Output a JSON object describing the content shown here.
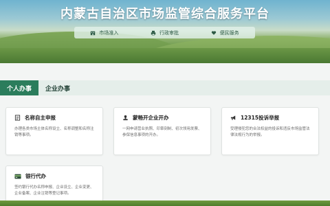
{
  "header": {
    "title": "内蒙古自治区市场监管综合服务平台"
  },
  "nav": [
    {
      "label": "市场准入",
      "icon": "building-icon"
    },
    {
      "label": "行政审批",
      "icon": "printer-icon"
    },
    {
      "label": "便民服务",
      "icon": "heart-hands-icon"
    }
  ],
  "tabs": [
    {
      "label": "个人办事",
      "active": true
    },
    {
      "label": "企业办事",
      "active": false
    }
  ],
  "cards": [
    {
      "title": "名称自主申报",
      "desc": "办理各类市场主体名称设立、名称调整和名称注销等事项。",
      "icon": "document-icon"
    },
    {
      "title": "蒙畅开企业开办",
      "desc": "一网申请营业执照、印章刻制、初次领用发票、参保信息事项的开办。",
      "icon": "seal-icon"
    },
    {
      "title": "12315投诉举报",
      "desc": "受理侵犯您的合法权益的投诉和违反市场监管法律法规行为的举报。",
      "icon": "megaphone-icon"
    },
    {
      "title": "银行代办",
      "desc": "签约银行代办名称申报、企业设立、企业变更、企业备案、企业注销等登记事项。",
      "icon": "bank-card-icon"
    }
  ],
  "watermark": "",
  "colors": {
    "accent": "#2b7d5c",
    "tab_bar": "#e5eeea",
    "title_text": "#ffffff"
  }
}
